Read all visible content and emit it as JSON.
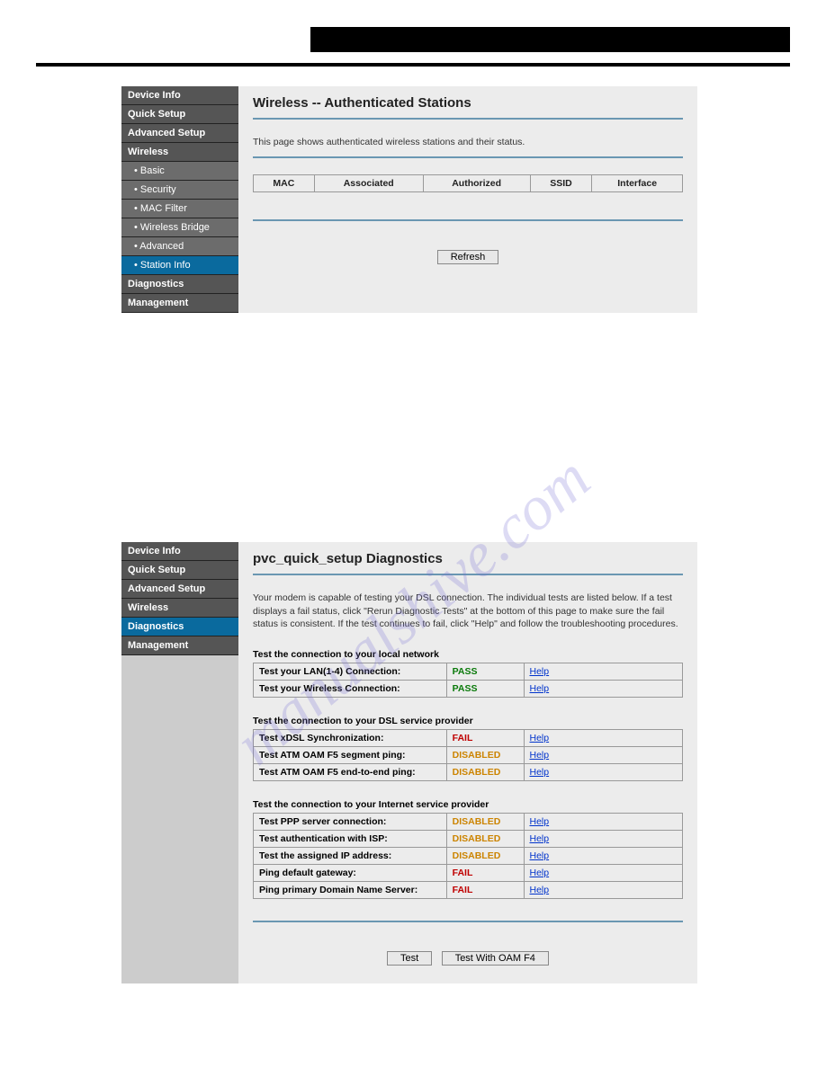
{
  "watermark": "manualshive.com",
  "panel1": {
    "nav": [
      {
        "label": "Device Info",
        "sub": false,
        "active": false
      },
      {
        "label": "Quick Setup",
        "sub": false,
        "active": false
      },
      {
        "label": "Advanced Setup",
        "sub": false,
        "active": false
      },
      {
        "label": "Wireless",
        "sub": false,
        "active": false
      },
      {
        "label": "• Basic",
        "sub": true,
        "active": false
      },
      {
        "label": "• Security",
        "sub": true,
        "active": false
      },
      {
        "label": "• MAC Filter",
        "sub": true,
        "active": false
      },
      {
        "label": "• Wireless Bridge",
        "sub": true,
        "active": false
      },
      {
        "label": "• Advanced",
        "sub": true,
        "active": false
      },
      {
        "label": "• Station Info",
        "sub": true,
        "active": true
      },
      {
        "label": "Diagnostics",
        "sub": false,
        "active": false
      },
      {
        "label": "Management",
        "sub": false,
        "active": false
      }
    ],
    "title": "Wireless -- Authenticated Stations",
    "desc": "This page shows authenticated wireless stations and their status.",
    "columns": [
      "MAC",
      "Associated",
      "Authorized",
      "SSID",
      "Interface"
    ],
    "refresh": "Refresh"
  },
  "panel2": {
    "nav": [
      {
        "label": "Device Info",
        "sub": false,
        "active": false
      },
      {
        "label": "Quick Setup",
        "sub": false,
        "active": false
      },
      {
        "label": "Advanced Setup",
        "sub": false,
        "active": false
      },
      {
        "label": "Wireless",
        "sub": false,
        "active": false
      },
      {
        "label": "Diagnostics",
        "sub": false,
        "active": true
      },
      {
        "label": "Management",
        "sub": false,
        "active": false
      }
    ],
    "title": "pvc_quick_setup Diagnostics",
    "desc": "Your modem is capable of testing your DSL connection. The individual tests are listed below. If a test displays a fail status, click \"Rerun Diagnostic Tests\" at the bottom of this page to make sure the fail status is consistent. If the test continues to fail, click \"Help\" and follow the troubleshooting procedures.",
    "sections": [
      {
        "heading": "Test the connection to your local network",
        "rows": [
          {
            "test": "Test your LAN(1-4) Connection:",
            "status": "PASS",
            "help": "Help"
          },
          {
            "test": "Test your Wireless Connection:",
            "status": "PASS",
            "help": "Help"
          }
        ]
      },
      {
        "heading": "Test the connection to your DSL service provider",
        "rows": [
          {
            "test": "Test xDSL Synchronization:",
            "status": "FAIL",
            "help": "Help"
          },
          {
            "test": "Test ATM OAM F5 segment ping:",
            "status": "DISABLED",
            "help": "Help"
          },
          {
            "test": "Test ATM OAM F5 end-to-end ping:",
            "status": "DISABLED",
            "help": "Help"
          }
        ]
      },
      {
        "heading": "Test the connection to your Internet service provider",
        "rows": [
          {
            "test": "Test PPP server connection:",
            "status": "DISABLED",
            "help": "Help"
          },
          {
            "test": "Test authentication with ISP:",
            "status": "DISABLED",
            "help": "Help"
          },
          {
            "test": "Test the assigned IP address:",
            "status": "DISABLED",
            "help": "Help"
          },
          {
            "test": "Ping default gateway:",
            "status": "FAIL",
            "help": "Help"
          },
          {
            "test": "Ping primary Domain Name Server:",
            "status": "FAIL",
            "help": "Help"
          }
        ]
      }
    ],
    "buttons": {
      "test": "Test",
      "testF4": "Test With OAM F4"
    }
  }
}
